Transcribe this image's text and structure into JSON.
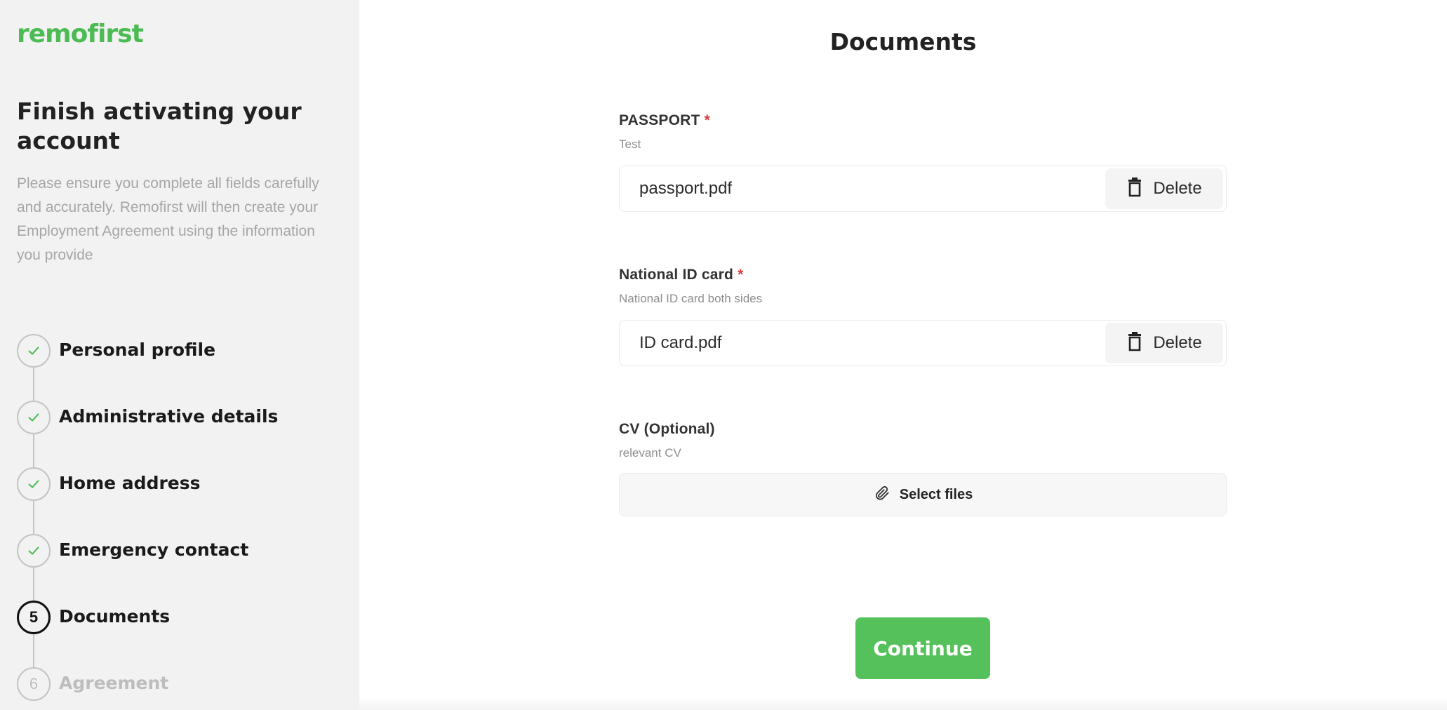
{
  "brand": {
    "logo_text": "remofirst",
    "accent_color": "#4cbb54"
  },
  "sidebar": {
    "title": "Finish activating your account",
    "description": "Please ensure you complete all fields carefully and accurately. Remofirst will then create your Employment Agreement using the information you provide",
    "steps": [
      {
        "label": "Personal profile",
        "status": "completed",
        "marker": ""
      },
      {
        "label": "Administrative details",
        "status": "completed",
        "marker": ""
      },
      {
        "label": "Home address",
        "status": "completed",
        "marker": ""
      },
      {
        "label": "Emergency contact",
        "status": "completed",
        "marker": ""
      },
      {
        "label": "Documents",
        "status": "active",
        "marker": "5"
      },
      {
        "label": "Agreement",
        "status": "upcoming",
        "marker": "6"
      }
    ]
  },
  "main": {
    "title": "Documents",
    "fields": [
      {
        "label": "PASSPORT",
        "required_mark": "*",
        "hint": "Test",
        "file_name": "passport.pdf",
        "delete_label": "Delete"
      },
      {
        "label": "National ID card",
        "required_mark": "*",
        "hint": "National ID card both sides",
        "file_name": "ID card.pdf",
        "delete_label": "Delete"
      },
      {
        "label": "CV (Optional)",
        "hint": "relevant CV",
        "select_label": "Select files"
      }
    ],
    "continue_label": "Continue"
  }
}
